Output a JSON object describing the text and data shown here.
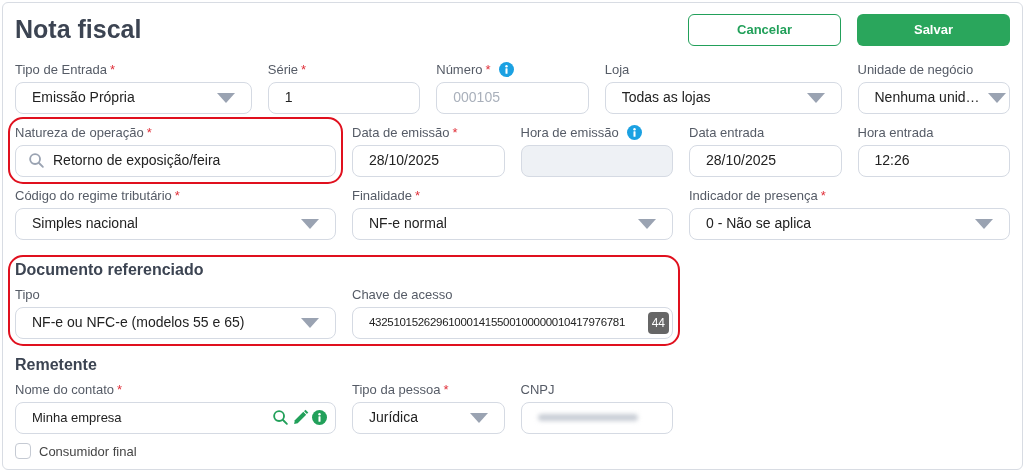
{
  "title": "Nota fiscal",
  "buttons": [
    {
      "label": "Cancelar",
      "kind": "secondary"
    },
    {
      "label": "Salvar",
      "kind": "primary"
    }
  ],
  "rows": [
    [
      {
        "label": "Tipo de Entrada",
        "required_mark": "*",
        "kind": "select",
        "value": "Emissão Própria"
      },
      {
        "label": "Série",
        "required_mark": "*",
        "kind": "input",
        "value": "1"
      },
      {
        "label": "Número",
        "required_mark": "*",
        "info": true,
        "kind": "input",
        "placeholder": "000105"
      },
      {
        "label": "Loja",
        "kind": "select",
        "value": "Todas as lojas"
      },
      {
        "label": "Unidade de negócio",
        "kind": "select",
        "value": "Nenhuma unid…"
      }
    ],
    [
      {
        "label": "Natureza de operação",
        "required_mark": "*",
        "kind": "search",
        "value": "Retorno de exposição/feira",
        "highlighted": true
      },
      {
        "label": "Data de emissão",
        "required_mark": "*",
        "kind": "input",
        "value": "28/10/2025"
      },
      {
        "label": "Hora de emissão",
        "info": true,
        "kind": "input",
        "disabled": true
      },
      {
        "label": "Data entrada",
        "kind": "input",
        "value": "28/10/2025"
      },
      {
        "label": "Hora entrada",
        "kind": "input",
        "value": "12:26"
      }
    ],
    [
      {
        "label": "Código do regime tributário",
        "required_mark": "*",
        "kind": "select",
        "value": "Simples nacional"
      },
      {
        "label": "Finalidade",
        "required_mark": "*",
        "kind": "select",
        "value": "NF-e normal"
      },
      {
        "label": "Indicador de presença",
        "required_mark": "*",
        "kind": "select",
        "value": "0 - Não se aplica"
      }
    ]
  ],
  "sections": [
    {
      "title": "Documento referenciado",
      "highlighted": true,
      "fields": [
        {
          "label": "Tipo",
          "kind": "select",
          "value": "NF-e ou NFC-e (modelos 55 e 65)"
        },
        {
          "label": "Chave de acesso",
          "kind": "counter",
          "value": "432510152629610001415500100000010417976781",
          "badge": "44"
        }
      ]
    },
    {
      "title": "Remetente",
      "fields": [
        {
          "label": "Nome do contato",
          "required_mark": "*",
          "kind": "contact",
          "value": "Minha empresa"
        },
        {
          "label": "Tipo da pessoa",
          "required_mark": "*",
          "kind": "select",
          "value": "Jurídica"
        },
        {
          "label": "CNPJ",
          "kind": "blurred"
        }
      ],
      "checkbox": {
        "label": "Consumidor final",
        "checked": false
      }
    }
  ]
}
